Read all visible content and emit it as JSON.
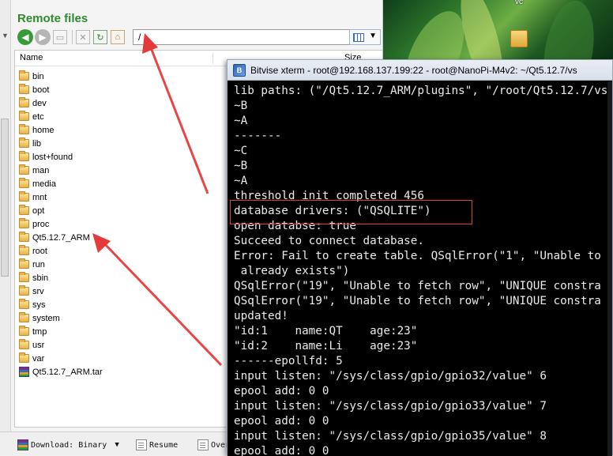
{
  "remote": {
    "title": "Remote files",
    "path": "/",
    "columns": {
      "name": "Name",
      "size": "Size"
    },
    "items": [
      {
        "label": "bin",
        "type": "folder"
      },
      {
        "label": "boot",
        "type": "folder"
      },
      {
        "label": "dev",
        "type": "folder"
      },
      {
        "label": "etc",
        "type": "folder"
      },
      {
        "label": "home",
        "type": "folder"
      },
      {
        "label": "lib",
        "type": "folder"
      },
      {
        "label": "lost+found",
        "type": "folder"
      },
      {
        "label": "man",
        "type": "folder"
      },
      {
        "label": "media",
        "type": "folder"
      },
      {
        "label": "mnt",
        "type": "folder"
      },
      {
        "label": "opt",
        "type": "folder"
      },
      {
        "label": "proc",
        "type": "folder"
      },
      {
        "label": "Qt5.12.7_ARM",
        "type": "folder"
      },
      {
        "label": "root",
        "type": "folder"
      },
      {
        "label": "run",
        "type": "folder"
      },
      {
        "label": "sbin",
        "type": "folder"
      },
      {
        "label": "srv",
        "type": "folder"
      },
      {
        "label": "sys",
        "type": "folder"
      },
      {
        "label": "system",
        "type": "folder"
      },
      {
        "label": "tmp",
        "type": "folder"
      },
      {
        "label": "usr",
        "type": "folder"
      },
      {
        "label": "var",
        "type": "folder"
      },
      {
        "label": "Qt5.12.7_ARM.tar",
        "type": "archive"
      }
    ],
    "bottom": {
      "download": "Download: Binary",
      "resume": "Resume",
      "overwrite": "Over"
    }
  },
  "desktop": {
    "label": "vc"
  },
  "xterm": {
    "title": "Bitvise xterm - root@192.168.137.199:22 - root@NanoPi-M4v2: ~/Qt5.12.7/vs",
    "lines": [
      "lib paths: (\"/Qt5.12.7_ARM/plugins\", \"/root/Qt5.12.7/vs",
      "~B",
      "~A",
      "-------",
      "~C",
      "~B",
      "~A",
      "threshold init completed 456",
      "database drivers: (\"QSQLITE\")",
      "open databse: true",
      "Succeed to connect database.",
      "Error: Fail to create table. QSqlError(\"1\", \"Unable to",
      " already exists\")",
      "QSqlError(\"19\", \"Unable to fetch row\", \"UNIQUE constra",
      "QSqlError(\"19\", \"Unable to fetch row\", \"UNIQUE constra",
      "updated!",
      "\"id:1    name:QT    age:23\"",
      "\"id:2    name:Li    age:23\"",
      "------epollfd: 5",
      "input listen: \"/sys/class/gpio/gpio32/value\" 6",
      "epool add: 0 0",
      "input listen: \"/sys/class/gpio/gpio33/value\" 7",
      "epool add: 0 0",
      "input listen: \"/sys/class/gpio/gpio35/value\" 8",
      "epool add: 0 0"
    ]
  },
  "colors": {
    "title_green": "#2e8b2e",
    "annotation_red": "#e33b3b",
    "terminal_bg": "#000000",
    "terminal_fg": "#eaeaea"
  }
}
